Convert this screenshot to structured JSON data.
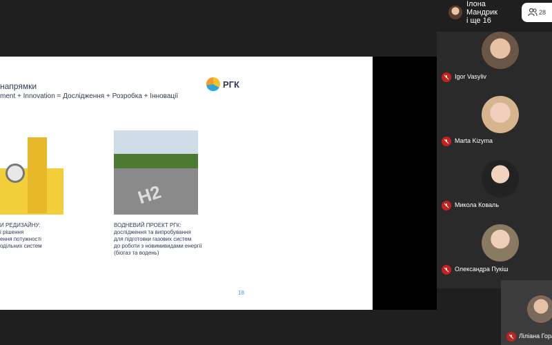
{
  "header": {
    "presenter_name": "Ілона Мандрик",
    "presenter_more": "і ще 16",
    "people_count": "28"
  },
  "slide": {
    "title": "напрямки",
    "subtitle": "ment + Innovation = Дослідження + Розробка + Інновації",
    "logo_text": "РГК",
    "caption_left": "И РЕДИЗАЙНУ:\nі рішення\nення потужності\nодільних систем",
    "caption_right": "ВОДНЕВИЙ ПРОЕКТ РГК:\nдослідження та випробування\nдля підготовки газових систем\nдо роботи з новимивидами енергії\n(біогаз та водень)",
    "page_number": "18",
    "photo_text": "H2"
  },
  "participants": [
    {
      "name": "Igor Vasyliv"
    },
    {
      "name": "Marta Kizyma"
    },
    {
      "name": "Микола Коваль"
    },
    {
      "name": "Олександра Пукіш"
    }
  ],
  "self_view": {
    "name": "Ліліана Гора"
  },
  "icons": {
    "mic_off": "mic-off-icon",
    "people": "people-icon"
  },
  "colors": {
    "accent": "#2fa4dc",
    "mic_off": "#c5221f"
  }
}
